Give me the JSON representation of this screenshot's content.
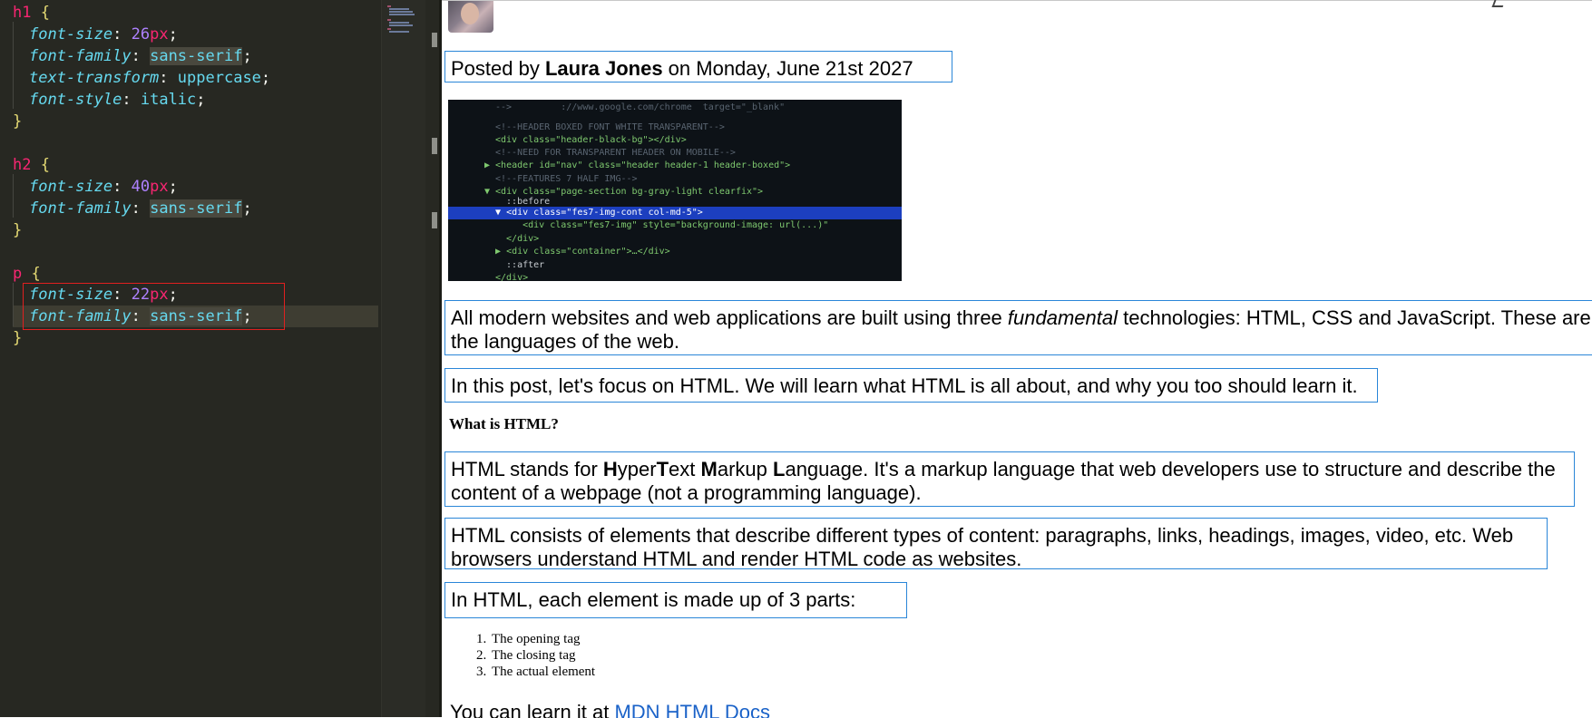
{
  "editor": {
    "lines": [
      {
        "selector": "h1"
      },
      {
        "prop": "font-size",
        "num": "26",
        "unit": "px"
      },
      {
        "prop": "font-family",
        "value": "sans-serif"
      },
      {
        "prop": "text-transform",
        "value": "uppercase"
      },
      {
        "prop": "font-style",
        "value": "italic"
      },
      {
        "selector": "h2"
      },
      {
        "prop": "font-size",
        "num": "40",
        "unit": "px"
      },
      {
        "prop": "font-family",
        "value": "sans-serif"
      },
      {
        "selector": "p"
      },
      {
        "prop": "font-size",
        "num": "22",
        "unit": "px"
      },
      {
        "prop": "font-family",
        "value": "sans-serif"
      }
    ],
    "open_brace": "{",
    "close_brace": "}",
    "colon": ":",
    "semicolon": ";"
  },
  "preview": {
    "byline": {
      "prefix": "Posted by ",
      "author": "Laura Jones",
      "suffix": " on Monday, June 21st 2027"
    },
    "p1": {
      "before": "All modern websites and web applications are built using three ",
      "em": "fundamental",
      "after": " technologies: HTML, CSS and JavaScript. These are the languages of the web."
    },
    "p2": "In this post, let's focus on HTML. We will learn what HTML is all about, and why you too should learn it.",
    "heading": "What is HTML?",
    "p3": {
      "a": "HTML stands for ",
      "b1": "H",
      "a2": "yper",
      "b2": "T",
      "a3": "ext ",
      "b3": "M",
      "a4": "arkup ",
      "b4": "L",
      "a5": "anguage. It's a markup language that web developers use to structure and describe the content of a webpage (not a programming language)."
    },
    "p4": "HTML consists of elements that describe different types of content: paragraphs, links, headings, images, video, etc. Web browsers understand HTML and render HTML code as websites.",
    "p5": "In HTML, each element is made up of 3 parts:",
    "steps": [
      "The opening tag",
      "The closing tag",
      "The actual element"
    ],
    "p6": {
      "text": "You can learn it at ",
      "link": "MDN HTML Docs"
    },
    "hero_code": [
      "-->         ://www.google.com/chrome  target=\"_blank\"",
      "<!--HEADER BOXED FONT WHITE TRANSPARENT-->",
      "<div class=\"header-black-bg\"></div>",
      "<!--NEED FOR TRANSPARENT HEADER ON MOBILE-->",
      "▶ <header id=\"nav\" class=\"header header-1 header-boxed\">",
      "<!--FEATURES 7 HALF IMG-->",
      "▼ <div class=\"page-section bg-gray-light clearfix\">",
      "  ::before",
      "  ▼ <div class=\"fes7-img-cont col-md-5\">",
      "     <div class=\"fes7-img\" style=\"background-image: url(...)\"",
      "  </div>",
      "  ▶ <div class=\"container\">…</div>",
      "  ::after",
      "</div>"
    ]
  }
}
